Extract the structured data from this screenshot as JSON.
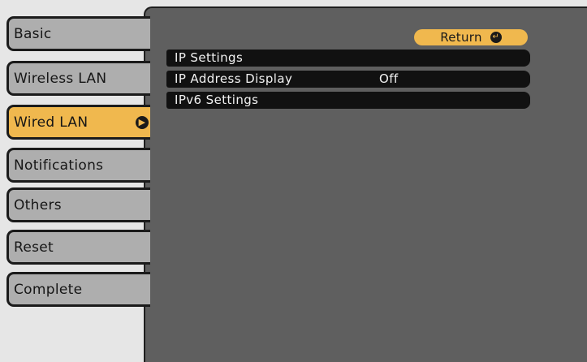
{
  "sidebar": {
    "items": [
      {
        "label": "Basic"
      },
      {
        "label": "Wireless LAN"
      },
      {
        "label": "Wired LAN",
        "selected": true
      },
      {
        "label": "Notifications"
      },
      {
        "label": "Others"
      },
      {
        "label": "Reset"
      },
      {
        "label": "Complete"
      }
    ]
  },
  "main": {
    "return_label": "Return",
    "rows": [
      {
        "label": "IP Settings",
        "value": ""
      },
      {
        "label": "IP Address Display",
        "value": "Off"
      },
      {
        "label": "IPv6 Settings",
        "value": ""
      }
    ]
  },
  "icons": {
    "selected_tab_arrow": "arrow-right-icon",
    "return_icon": "return-arrow-icon"
  },
  "colors": {
    "accent": "#f0b84e",
    "panel": "#5f5f5f",
    "tab": "#aeaeae",
    "row": "#111111"
  }
}
